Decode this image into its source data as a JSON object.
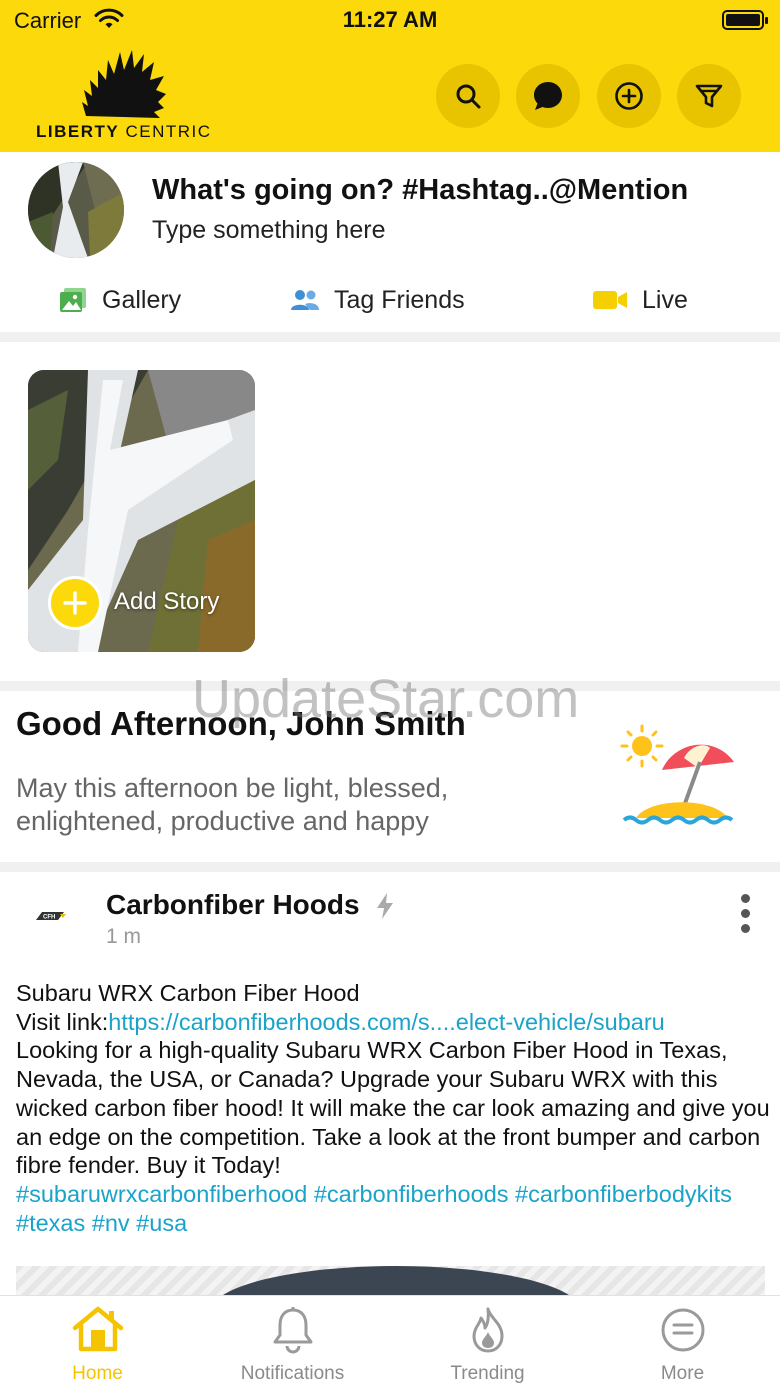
{
  "status_bar": {
    "carrier": "Carrier",
    "time": "11:27 AM"
  },
  "brand": {
    "logo_word1": "LIBERTY",
    "logo_word2": "CENTRIC",
    "color": "#fbd90a"
  },
  "header_actions": [
    {
      "name": "search-icon"
    },
    {
      "name": "chat-icon"
    },
    {
      "name": "add-circle-icon"
    },
    {
      "name": "filter-icon"
    }
  ],
  "composer": {
    "title": "What's going on? #Hashtag..@Mention",
    "placeholder": "Type something here",
    "actions": [
      {
        "label": "Gallery",
        "icon": "gallery-icon",
        "color": "#5cb85c"
      },
      {
        "label": "Tag Friends",
        "icon": "users-icon",
        "color": "#3d8fd6"
      },
      {
        "label": "Live",
        "icon": "video-camera-icon",
        "color": "#f5d000"
      }
    ]
  },
  "stories": {
    "add_label": "Add Story"
  },
  "greeting": {
    "title": "Good Afternoon, John Smith",
    "message": "May this afternoon be light, blessed, enlightened, productive and happy"
  },
  "watermark": "UpdateStar.com",
  "post": {
    "author": "Carbonfiber Hoods",
    "time": "1 m",
    "line1": "Subaru WRX Carbon Fiber Hood",
    "link_prefix": "Visit link:",
    "link": "https://carbonfiberhoods.com/s....elect-vehicle/subaru",
    "body": "Looking for a high-quality Subaru WRX Carbon Fiber Hood in Texas, Nevada, the USA, or Canada? Upgrade your Subaru WRX with this wicked carbon fiber hood! It will make the car look amazing and give you an edge on the competition. Take a look at the front bumper and carbon fibre fender. Buy it Today!",
    "hashtags": "#subaruwrxcarbonfiberhood #carbonfiberhoods #carbonfiberbodykits #texas #nv #usa"
  },
  "tabs": [
    {
      "label": "Home",
      "icon": "home-icon",
      "active": true
    },
    {
      "label": "Notifications",
      "icon": "bell-icon",
      "active": false
    },
    {
      "label": "Trending",
      "icon": "flame-icon",
      "active": false
    },
    {
      "label": "More",
      "icon": "menu-circle-icon",
      "active": false
    }
  ]
}
